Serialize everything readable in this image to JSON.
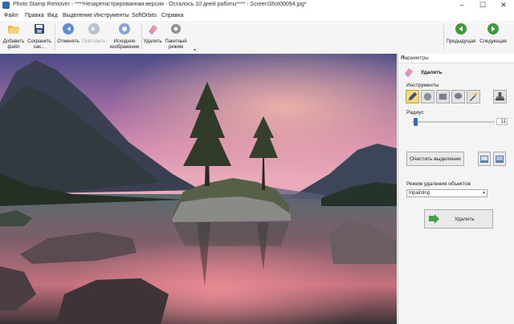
{
  "window": {
    "title": "Photo Stamp Remover - ****Незарегистрированная версия - Осталось 10 дней работы**** - ScreenShot00094.jpg*"
  },
  "menu": [
    "Файл",
    "Правка",
    "Вид",
    "Выделение",
    "Инструменты",
    "SoftOrbits",
    "Справка"
  ],
  "toolbar": {
    "add_file": "Добавить\nфайл",
    "save_as": "Сохранить\nкак...",
    "undo": "Отменить",
    "redo": "Повторить",
    "original": "Исходное\nизображение",
    "remove": "Удалить",
    "batch": "Пакетный\nрежим",
    "prev": "Предыдущая",
    "next": "Следующая"
  },
  "panel": {
    "header": "Параметры",
    "section_title": "Удалить",
    "tools_label": "Инструменты",
    "radius_label": "Радиус",
    "radius_value": "11",
    "clear_selection": "Очистить выделение",
    "mode_label": "Режим удаления объектов",
    "mode_value": "Inpainting",
    "remove_button": "Удалить"
  },
  "controls": {
    "radius_slider_fraction": 0.04
  },
  "icons": [
    "app-icon",
    "folder-open-icon",
    "save-icon",
    "undo-icon",
    "redo-icon",
    "original-image-icon",
    "eraser-icon",
    "gear-icon",
    "arrow-left-icon",
    "arrow-right-icon",
    "pencil-icon",
    "brush-icon",
    "rect-select-icon",
    "lasso-icon",
    "magic-wand-icon",
    "stamp-icon"
  ]
}
